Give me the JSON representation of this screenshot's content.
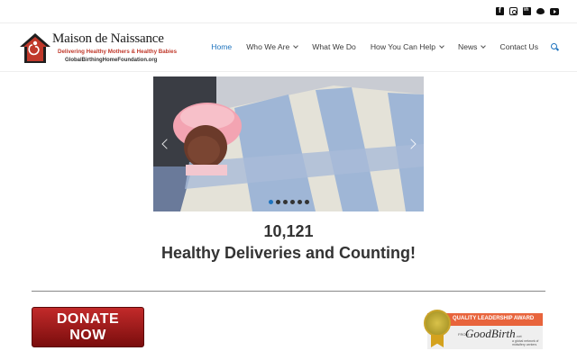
{
  "social": {
    "icons": [
      "facebook-icon",
      "instagram-icon",
      "linkedin-icon",
      "twitter-icon",
      "youtube-icon"
    ]
  },
  "header": {
    "brand_name": "Maison de Naissance",
    "tagline": "Delivering Healthy Mothers & Healthy Babies",
    "url_text": "GlobalBirthingHomeFoundation.org"
  },
  "nav": {
    "items": [
      {
        "label": "Home",
        "active": true,
        "has_dropdown": false
      },
      {
        "label": "Who We Are",
        "active": false,
        "has_dropdown": true
      },
      {
        "label": "What We Do",
        "active": false,
        "has_dropdown": false
      },
      {
        "label": "How You Can Help",
        "active": false,
        "has_dropdown": true
      },
      {
        "label": "News",
        "active": false,
        "has_dropdown": true
      },
      {
        "label": "Contact Us",
        "active": false,
        "has_dropdown": false
      }
    ],
    "search_icon": "search-icon"
  },
  "slider": {
    "slide_count": 6,
    "active_index": 0,
    "image_description": "newborn-wrapped-in-blanket"
  },
  "stats": {
    "count": "10,121",
    "headline": "Healthy Deliveries and Counting!"
  },
  "donate": {
    "line1": "DONATE",
    "line2": "NOW"
  },
  "award": {
    "banner": "QUALITY LEADERSHIP AWARD",
    "from": "FROM",
    "brand": "GoodBirth",
    "net": ".net",
    "sub": "a global network of midwifery centers"
  },
  "colors": {
    "accent": "#1e73be",
    "donate": "#b01e1e",
    "award_banner": "#e8643c",
    "logo_red": "#c0392b"
  }
}
